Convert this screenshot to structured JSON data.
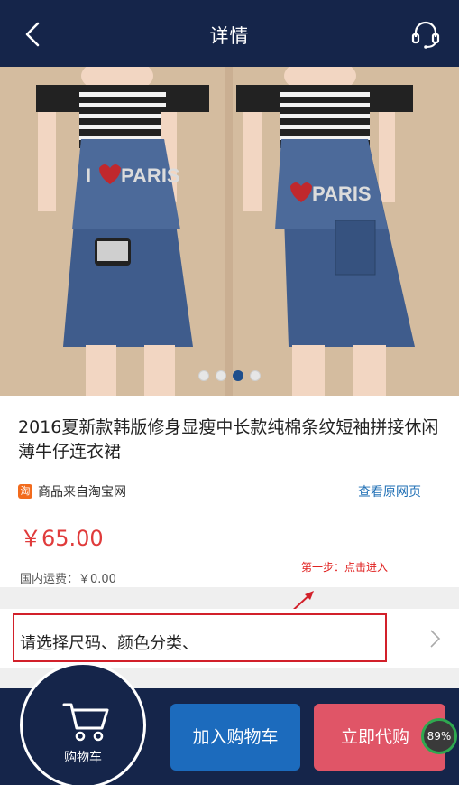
{
  "header": {
    "title": "详情",
    "back_icon": "chevron-left-icon",
    "service_icon": "headset-icon"
  },
  "hero": {
    "image": "product-photo",
    "carousel": {
      "count": 4,
      "active_index": 2
    }
  },
  "product": {
    "title": "2016夏新款韩版修身显瘦中长款纯棉条纹短袖拼接休闲薄牛仔连衣裙",
    "source_icon_text": "淘",
    "source_label": "商品来自淘宝网",
    "view_original": "查看原网页",
    "price": "￥65.00",
    "shipping": "国内运费：￥0.00"
  },
  "annotation": {
    "text": "第一步：点击进入"
  },
  "spec": {
    "label": "请选择尺码、颜色分类、"
  },
  "bottom": {
    "cart_label": "购物车",
    "add_to_cart": "加入购物车",
    "buy_now": "立即代购",
    "battery": "89%"
  },
  "colors": {
    "navy": "#15254a",
    "price_red": "#e03b3b",
    "link_blue": "#1f6fb5",
    "add_blue": "#1c6bbd",
    "buy_pink": "#e05567",
    "highlight_red": "#d2202a"
  }
}
